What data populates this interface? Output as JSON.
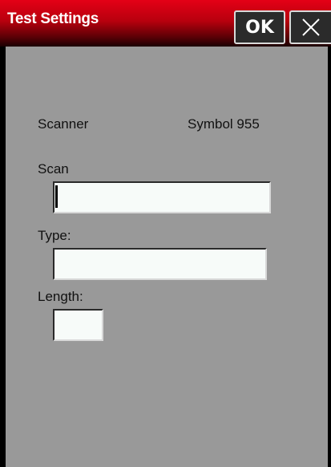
{
  "window": {
    "title": "Test Settings",
    "ok_label": "OK",
    "close_icon": "close-icon"
  },
  "form": {
    "scanner_label": "Scanner",
    "scanner_value": "Symbol 955",
    "scan_label": "Scan",
    "scan_value": "",
    "type_label": "Type:",
    "type_value": "",
    "length_label": "Length:",
    "length_value": ""
  },
  "colors": {
    "titlebar": "#c0000f",
    "background": "#999999",
    "field": "#f7fbf9"
  }
}
